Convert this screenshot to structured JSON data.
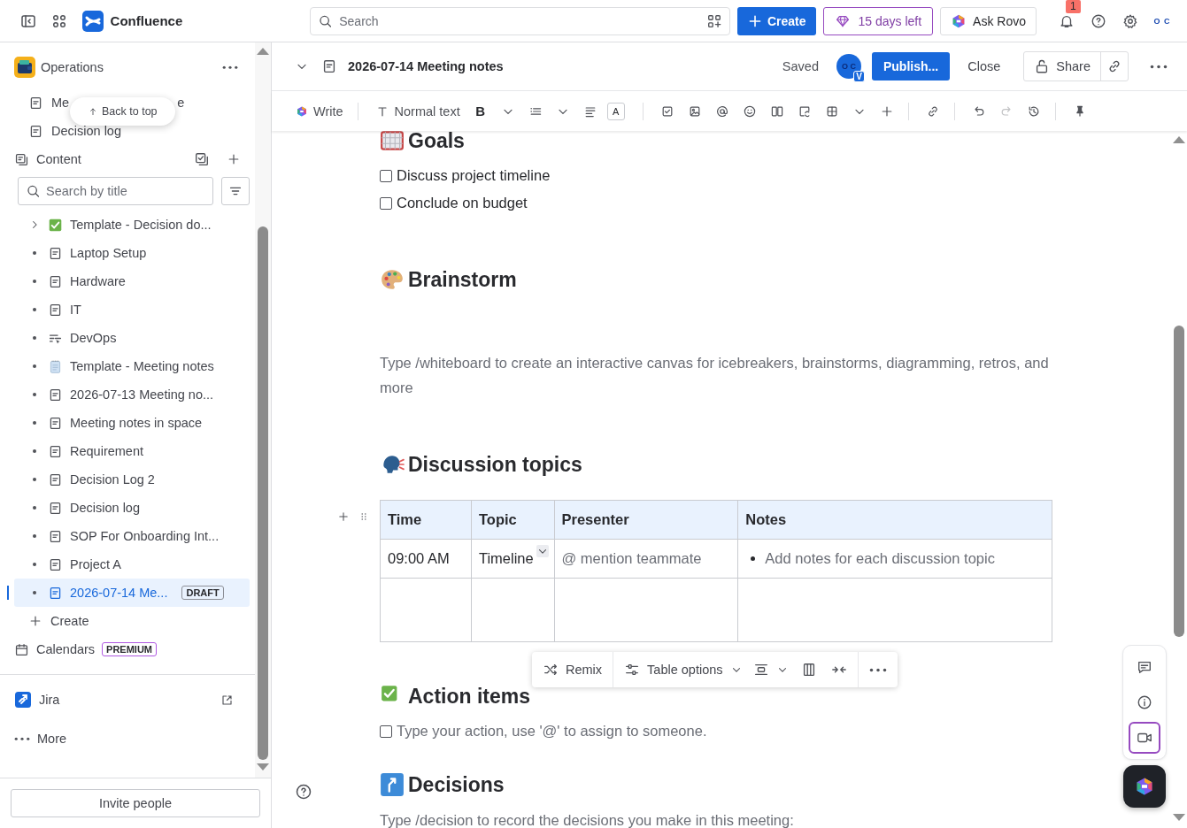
{
  "topbar": {
    "app_name": "Confluence",
    "search": {
      "placeholder": "Search"
    },
    "create_label": "Create",
    "trial_label": "15 days left",
    "rovo_label": "Ask Rovo",
    "notification_count": "1",
    "avatar_text": "O C"
  },
  "sidebar": {
    "space_name": "Operations",
    "shortcuts": [
      {
        "label_parts": [
          "Me",
          "e"
        ]
      },
      {
        "label_parts": [
          "Decision log"
        ]
      }
    ],
    "back_to_top": "Back to top",
    "content_label": "Content",
    "search": {
      "placeholder": "Search by title"
    },
    "tree": [
      {
        "label": "Template - Decision do...",
        "kind": "check",
        "expanded": false,
        "selected": false
      },
      {
        "label": "Laptop Setup",
        "kind": "page",
        "selected": false
      },
      {
        "label": "Hardware",
        "kind": "page",
        "selected": false
      },
      {
        "label": "IT",
        "kind": "page",
        "selected": false
      },
      {
        "label": "DevOps",
        "kind": "live",
        "selected": false
      },
      {
        "label": "Template - Meeting notes",
        "kind": "notepad",
        "selected": false
      },
      {
        "label": "2026-07-13 Meeting no...",
        "kind": "page",
        "selected": false
      },
      {
        "label": "Meeting notes in space",
        "kind": "page",
        "selected": false
      },
      {
        "label": "Requirement",
        "kind": "page",
        "selected": false
      },
      {
        "label": "Decision Log 2",
        "kind": "page",
        "selected": false
      },
      {
        "label": "Decision log",
        "kind": "page",
        "selected": false
      },
      {
        "label": "SOP For Onboarding Int...",
        "kind": "page",
        "selected": false
      },
      {
        "label": "Project A",
        "kind": "page",
        "selected": false
      },
      {
        "label": "2026-07-14 Me...",
        "kind": "page",
        "selected": true,
        "badge": "DRAFT"
      }
    ],
    "create_label": "Create",
    "calendars": {
      "label": "Calendars",
      "badge": "PREMIUM"
    },
    "apps": [
      {
        "label": "Jira",
        "kind": "jira"
      },
      {
        "label": "More",
        "kind": "more"
      }
    ],
    "invite_label": "Invite people"
  },
  "page": {
    "title": "2026-07-14 Meeting notes",
    "status": "Saved",
    "avatar_text": "O C",
    "avatar_badge": "V",
    "publish_label": "Publish...",
    "close_label": "Close",
    "share_label": "Share"
  },
  "toolbar": [
    {
      "kind": "write",
      "label": "Write"
    },
    {
      "kind": "divider"
    },
    {
      "kind": "text-style",
      "label": "Normal text"
    },
    {
      "kind": "bold",
      "label": "B"
    },
    {
      "kind": "caret"
    },
    {
      "kind": "list"
    },
    {
      "kind": "caret"
    },
    {
      "kind": "align"
    },
    {
      "kind": "color",
      "label": "A"
    },
    {
      "kind": "divider"
    },
    {
      "kind": "task"
    },
    {
      "kind": "image"
    },
    {
      "kind": "mention"
    },
    {
      "kind": "emoji"
    },
    {
      "kind": "layout"
    },
    {
      "kind": "macro"
    },
    {
      "kind": "table"
    },
    {
      "kind": "caret"
    },
    {
      "kind": "plus"
    },
    {
      "kind": "divider"
    },
    {
      "kind": "link"
    },
    {
      "kind": "divider"
    },
    {
      "kind": "undo"
    },
    {
      "kind": "redo",
      "disabled": true
    },
    {
      "kind": "history"
    },
    {
      "kind": "divider"
    },
    {
      "kind": "pin"
    }
  ],
  "content": [
    {
      "kind": "heading",
      "text": "Goals"
    },
    {
      "kind": "task",
      "text": "Discuss project timeline",
      "checked": false
    },
    {
      "kind": "task",
      "text": "Conclude on budget",
      "checked": false
    },
    {
      "kind": "heading",
      "text": "Brainstorm"
    },
    {
      "kind": "hint",
      "text": "Type /whiteboard to create an interactive canvas for icebreakers, brainstorms, diagramming, retros, and more"
    },
    {
      "kind": "heading",
      "text": "Discussion topics"
    },
    {
      "kind": "table",
      "columns": [
        "Time",
        "Topic",
        "Presenter",
        "Notes"
      ],
      "rows": [
        [
          {
            "kind": "text",
            "text": "09:00 AM"
          },
          {
            "kind": "dropdown",
            "text": "Timeline"
          },
          {
            "kind": "placeholder",
            "text": "@ mention teammate"
          },
          {
            "kind": "bullet",
            "text": "Add notes for each discussion topic"
          }
        ],
        [
          {
            "kind": "empty"
          },
          {
            "kind": "empty"
          },
          {
            "kind": "empty"
          },
          {
            "kind": "empty"
          }
        ]
      ],
      "floating_toolbar": {
        "remix_label": "Remix",
        "options_label": "Table options"
      }
    },
    {
      "kind": "heading",
      "text": "Action items"
    },
    {
      "kind": "task-placeholder",
      "text": "Type your action, use '@' to assign to someone.",
      "checked": false
    },
    {
      "kind": "heading",
      "text": "Decisions"
    },
    {
      "kind": "hint",
      "text": "Type /decision to record the decisions you make in this meeting:"
    }
  ],
  "side_panel": [
    {
      "kind": "comment",
      "selected": false
    },
    {
      "kind": "info",
      "selected": false
    },
    {
      "kind": "video",
      "selected": true
    }
  ]
}
